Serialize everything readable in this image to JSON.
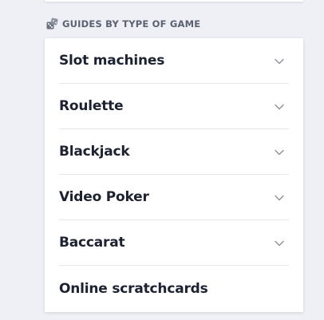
{
  "section": {
    "icon": "dice-icon",
    "title": "GUIDES BY TYPE OF GAME"
  },
  "accordion": {
    "items": [
      {
        "label": "Slot machines",
        "expandable": true
      },
      {
        "label": "Roulette",
        "expandable": true
      },
      {
        "label": "Blackjack",
        "expandable": true
      },
      {
        "label": "Video Poker",
        "expandable": true
      },
      {
        "label": "Baccarat",
        "expandable": true
      },
      {
        "label": "Online scratchcards",
        "expandable": false
      }
    ]
  },
  "colors": {
    "background": "#eef0f5",
    "card": "#ffffff",
    "text": "#1d2230",
    "muted": "#5a6170",
    "chevron": "#8a8f99",
    "divider": "#e4e6ea"
  }
}
